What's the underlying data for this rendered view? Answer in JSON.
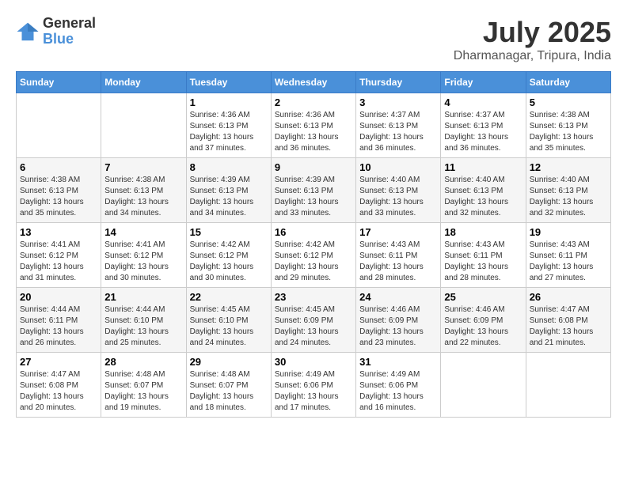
{
  "header": {
    "logo_general": "General",
    "logo_blue": "Blue",
    "month_year": "July 2025",
    "location": "Dharmanagar, Tripura, India"
  },
  "days_of_week": [
    "Sunday",
    "Monday",
    "Tuesday",
    "Wednesday",
    "Thursday",
    "Friday",
    "Saturday"
  ],
  "weeks": [
    [
      {
        "day": "",
        "sunrise": "",
        "sunset": "",
        "daylight": ""
      },
      {
        "day": "",
        "sunrise": "",
        "sunset": "",
        "daylight": ""
      },
      {
        "day": "1",
        "sunrise": "Sunrise: 4:36 AM",
        "sunset": "Sunset: 6:13 PM",
        "daylight": "Daylight: 13 hours and 37 minutes."
      },
      {
        "day": "2",
        "sunrise": "Sunrise: 4:36 AM",
        "sunset": "Sunset: 6:13 PM",
        "daylight": "Daylight: 13 hours and 36 minutes."
      },
      {
        "day": "3",
        "sunrise": "Sunrise: 4:37 AM",
        "sunset": "Sunset: 6:13 PM",
        "daylight": "Daylight: 13 hours and 36 minutes."
      },
      {
        "day": "4",
        "sunrise": "Sunrise: 4:37 AM",
        "sunset": "Sunset: 6:13 PM",
        "daylight": "Daylight: 13 hours and 36 minutes."
      },
      {
        "day": "5",
        "sunrise": "Sunrise: 4:38 AM",
        "sunset": "Sunset: 6:13 PM",
        "daylight": "Daylight: 13 hours and 35 minutes."
      }
    ],
    [
      {
        "day": "6",
        "sunrise": "Sunrise: 4:38 AM",
        "sunset": "Sunset: 6:13 PM",
        "daylight": "Daylight: 13 hours and 35 minutes."
      },
      {
        "day": "7",
        "sunrise": "Sunrise: 4:38 AM",
        "sunset": "Sunset: 6:13 PM",
        "daylight": "Daylight: 13 hours and 34 minutes."
      },
      {
        "day": "8",
        "sunrise": "Sunrise: 4:39 AM",
        "sunset": "Sunset: 6:13 PM",
        "daylight": "Daylight: 13 hours and 34 minutes."
      },
      {
        "day": "9",
        "sunrise": "Sunrise: 4:39 AM",
        "sunset": "Sunset: 6:13 PM",
        "daylight": "Daylight: 13 hours and 33 minutes."
      },
      {
        "day": "10",
        "sunrise": "Sunrise: 4:40 AM",
        "sunset": "Sunset: 6:13 PM",
        "daylight": "Daylight: 13 hours and 33 minutes."
      },
      {
        "day": "11",
        "sunrise": "Sunrise: 4:40 AM",
        "sunset": "Sunset: 6:13 PM",
        "daylight": "Daylight: 13 hours and 32 minutes."
      },
      {
        "day": "12",
        "sunrise": "Sunrise: 4:40 AM",
        "sunset": "Sunset: 6:13 PM",
        "daylight": "Daylight: 13 hours and 32 minutes."
      }
    ],
    [
      {
        "day": "13",
        "sunrise": "Sunrise: 4:41 AM",
        "sunset": "Sunset: 6:12 PM",
        "daylight": "Daylight: 13 hours and 31 minutes."
      },
      {
        "day": "14",
        "sunrise": "Sunrise: 4:41 AM",
        "sunset": "Sunset: 6:12 PM",
        "daylight": "Daylight: 13 hours and 30 minutes."
      },
      {
        "day": "15",
        "sunrise": "Sunrise: 4:42 AM",
        "sunset": "Sunset: 6:12 PM",
        "daylight": "Daylight: 13 hours and 30 minutes."
      },
      {
        "day": "16",
        "sunrise": "Sunrise: 4:42 AM",
        "sunset": "Sunset: 6:12 PM",
        "daylight": "Daylight: 13 hours and 29 minutes."
      },
      {
        "day": "17",
        "sunrise": "Sunrise: 4:43 AM",
        "sunset": "Sunset: 6:11 PM",
        "daylight": "Daylight: 13 hours and 28 minutes."
      },
      {
        "day": "18",
        "sunrise": "Sunrise: 4:43 AM",
        "sunset": "Sunset: 6:11 PM",
        "daylight": "Daylight: 13 hours and 28 minutes."
      },
      {
        "day": "19",
        "sunrise": "Sunrise: 4:43 AM",
        "sunset": "Sunset: 6:11 PM",
        "daylight": "Daylight: 13 hours and 27 minutes."
      }
    ],
    [
      {
        "day": "20",
        "sunrise": "Sunrise: 4:44 AM",
        "sunset": "Sunset: 6:11 PM",
        "daylight": "Daylight: 13 hours and 26 minutes."
      },
      {
        "day": "21",
        "sunrise": "Sunrise: 4:44 AM",
        "sunset": "Sunset: 6:10 PM",
        "daylight": "Daylight: 13 hours and 25 minutes."
      },
      {
        "day": "22",
        "sunrise": "Sunrise: 4:45 AM",
        "sunset": "Sunset: 6:10 PM",
        "daylight": "Daylight: 13 hours and 24 minutes."
      },
      {
        "day": "23",
        "sunrise": "Sunrise: 4:45 AM",
        "sunset": "Sunset: 6:09 PM",
        "daylight": "Daylight: 13 hours and 24 minutes."
      },
      {
        "day": "24",
        "sunrise": "Sunrise: 4:46 AM",
        "sunset": "Sunset: 6:09 PM",
        "daylight": "Daylight: 13 hours and 23 minutes."
      },
      {
        "day": "25",
        "sunrise": "Sunrise: 4:46 AM",
        "sunset": "Sunset: 6:09 PM",
        "daylight": "Daylight: 13 hours and 22 minutes."
      },
      {
        "day": "26",
        "sunrise": "Sunrise: 4:47 AM",
        "sunset": "Sunset: 6:08 PM",
        "daylight": "Daylight: 13 hours and 21 minutes."
      }
    ],
    [
      {
        "day": "27",
        "sunrise": "Sunrise: 4:47 AM",
        "sunset": "Sunset: 6:08 PM",
        "daylight": "Daylight: 13 hours and 20 minutes."
      },
      {
        "day": "28",
        "sunrise": "Sunrise: 4:48 AM",
        "sunset": "Sunset: 6:07 PM",
        "daylight": "Daylight: 13 hours and 19 minutes."
      },
      {
        "day": "29",
        "sunrise": "Sunrise: 4:48 AM",
        "sunset": "Sunset: 6:07 PM",
        "daylight": "Daylight: 13 hours and 18 minutes."
      },
      {
        "day": "30",
        "sunrise": "Sunrise: 4:49 AM",
        "sunset": "Sunset: 6:06 PM",
        "daylight": "Daylight: 13 hours and 17 minutes."
      },
      {
        "day": "31",
        "sunrise": "Sunrise: 4:49 AM",
        "sunset": "Sunset: 6:06 PM",
        "daylight": "Daylight: 13 hours and 16 minutes."
      },
      {
        "day": "",
        "sunrise": "",
        "sunset": "",
        "daylight": ""
      },
      {
        "day": "",
        "sunrise": "",
        "sunset": "",
        "daylight": ""
      }
    ]
  ]
}
